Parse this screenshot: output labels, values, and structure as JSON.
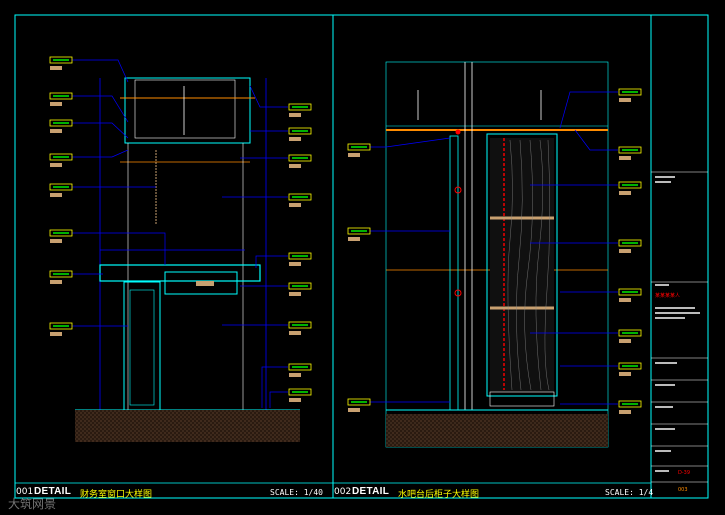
{
  "details": [
    {
      "number": "001",
      "label": "DETAIL",
      "title": "财务室窗口大样图",
      "scale": "SCALE: 1/40"
    },
    {
      "number": "002",
      "label": "DETAIL",
      "title": "水吧台后柜子大样图",
      "scale": "SCALE: 1/4"
    }
  ],
  "title_block": {
    "red_label": "某某某某人",
    "drawing_no": "D-39",
    "sheet_code": "003"
  },
  "watermark": "大筑网景",
  "colors": {
    "frame": "#00ffff",
    "line_blue": "#0000ff",
    "tag_yellow": "#ffff00",
    "tag_green": "#00ff00",
    "tan": "#c8a070",
    "orange": "#ff8c00",
    "red": "#ff0000"
  }
}
